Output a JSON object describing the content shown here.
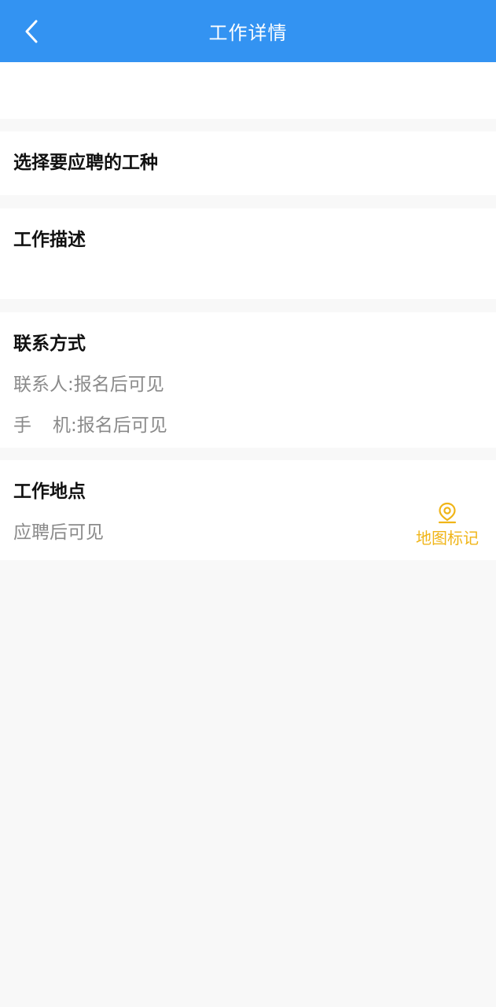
{
  "header": {
    "title": "工作详情",
    "back_icon": "chevron-left-icon"
  },
  "job_type": {
    "title": "选择要应聘的工种"
  },
  "description": {
    "title": "工作描述"
  },
  "contact": {
    "title": "联系方式",
    "person": "联系人:报名后可见",
    "phone_label": "手",
    "phone_rest": "机:报名后可见"
  },
  "location": {
    "title": "工作地点",
    "value": "应聘后可见",
    "map_button_label": "地图标记",
    "map_icon": "location-pin-icon"
  },
  "colors": {
    "header_bg": "#3393f2",
    "accent_map": "#f0b518",
    "muted_text": "#8a8a8a",
    "page_bg": "#f8f8f8"
  }
}
